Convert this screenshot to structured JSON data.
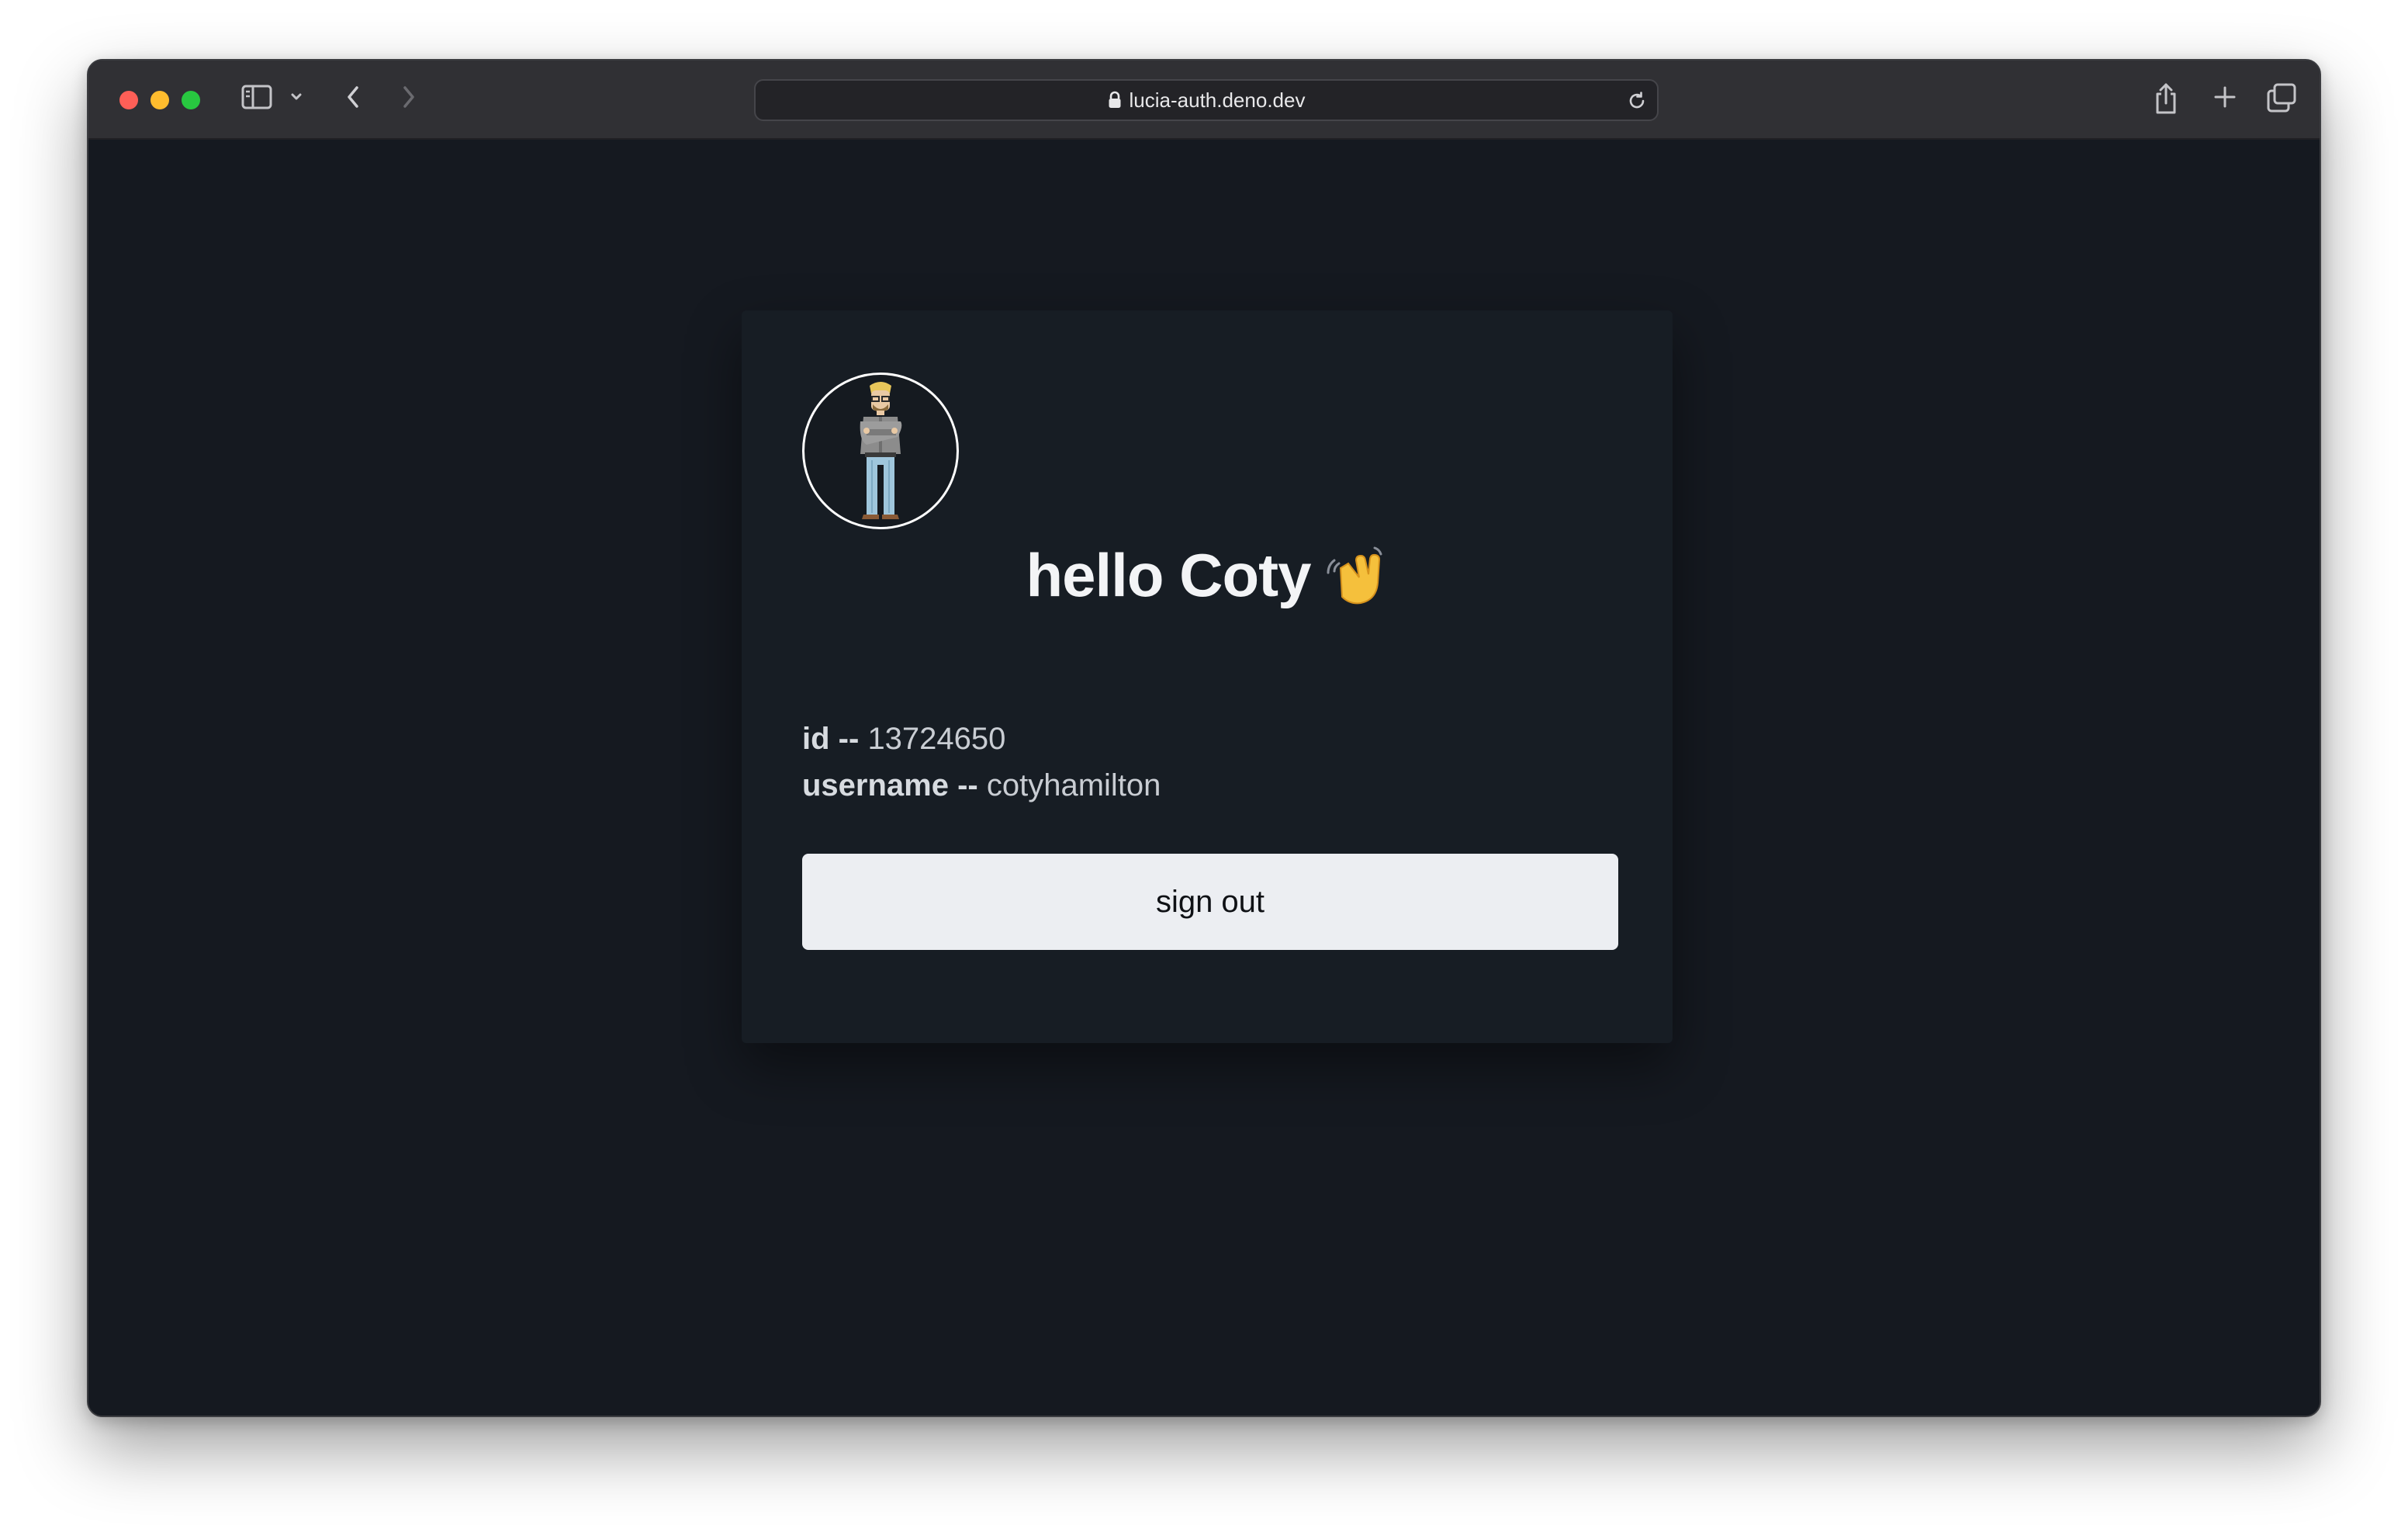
{
  "browser": {
    "url": "lucia-auth.deno.dev"
  },
  "page": {
    "greeting": "hello Coty",
    "wave_emoji_name": "waving-hand",
    "id_label": "id --",
    "id_value": "13724650",
    "username_label": "username --",
    "username_value": "cotyhamilton",
    "sign_out_label": "sign out"
  },
  "colors": {
    "page_background": "#151920",
    "card_background": "#171d24",
    "button_background": "#eceef2",
    "text_primary": "#f3f4f6"
  }
}
